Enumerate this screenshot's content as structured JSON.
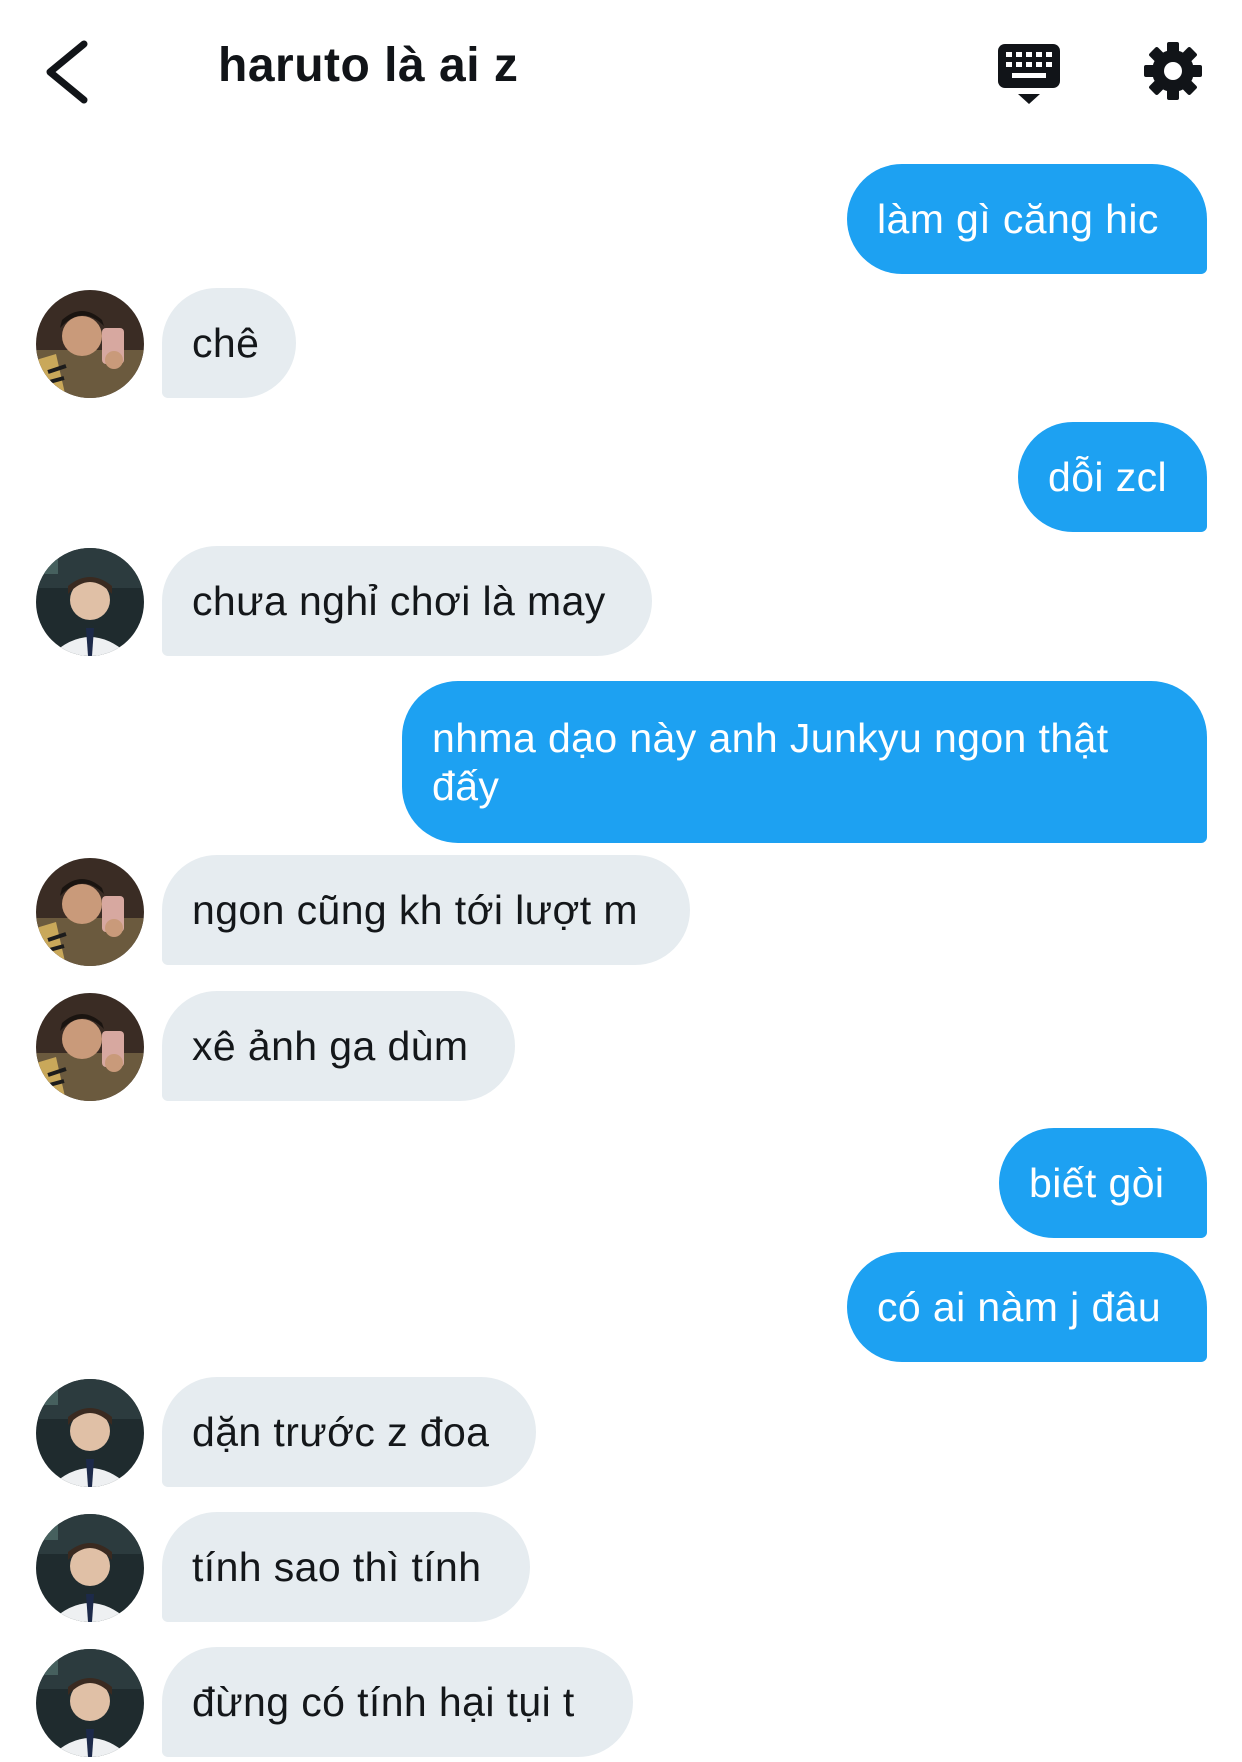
{
  "header": {
    "title": "haruto là ai z",
    "back_icon": "chevron-left-icon",
    "keyboard_icon": "keyboard-icon",
    "settings_icon": "gear-icon"
  },
  "colors": {
    "outgoing_bubble": "#1da1f2",
    "incoming_bubble": "#e6ecf0",
    "incoming_text": "#14171a"
  },
  "messages": [
    {
      "side": "out",
      "text": "làm gì căng hic"
    },
    {
      "side": "in",
      "text": "chê",
      "avatar": "avatar-a"
    },
    {
      "side": "out",
      "text": "dỗi zcl"
    },
    {
      "side": "in",
      "text": "chưa nghỉ chơi là may",
      "avatar": "avatar-b"
    },
    {
      "side": "out",
      "text": "nhma dạo này anh Junkyu ngon thật đấy"
    },
    {
      "side": "in",
      "text": "ngon cũng kh tới lượt m",
      "avatar": "avatar-a"
    },
    {
      "side": "in",
      "text": "xê ảnh ga dùm",
      "avatar": "avatar-a"
    },
    {
      "side": "out",
      "text": "biết gòi"
    },
    {
      "side": "out",
      "text": "có ai nàm j đâu"
    },
    {
      "side": "in",
      "text": "dặn trước z đoa",
      "avatar": "avatar-b"
    },
    {
      "side": "in",
      "text": "tính sao thì tính",
      "avatar": "avatar-b"
    },
    {
      "side": "in",
      "text": "đừng có tính hại tụi t",
      "avatar": "avatar-b"
    }
  ]
}
